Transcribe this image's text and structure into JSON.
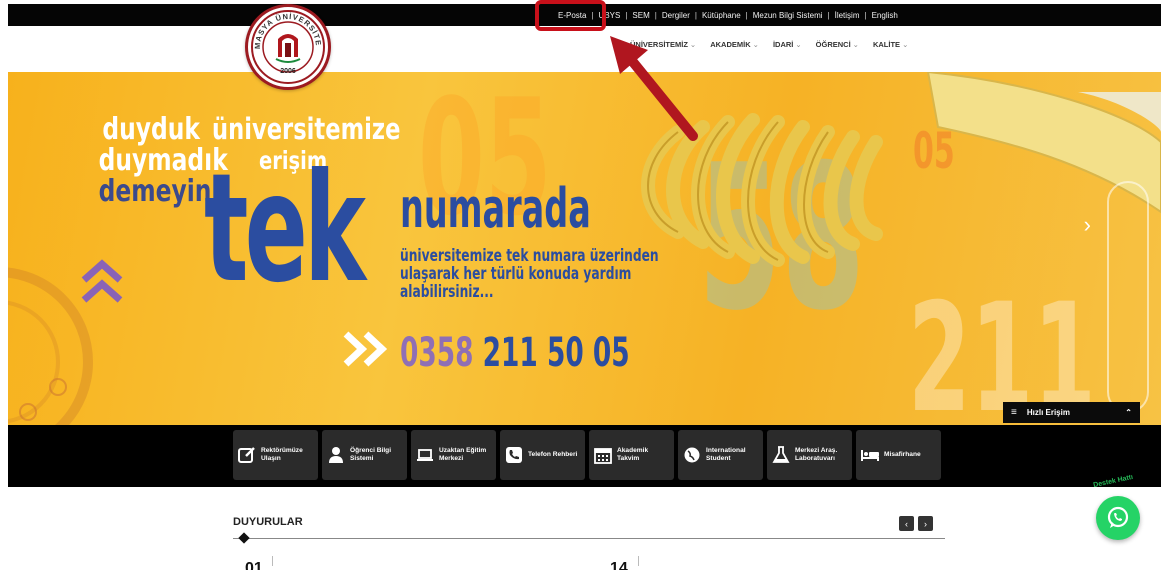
{
  "topbar": {
    "links": [
      "E-Posta",
      "UBYS",
      "SEM",
      "Dergiler",
      "Kütüphane",
      "Mezun Bilgi Sistemi",
      "İletişim",
      "English"
    ]
  },
  "nav": {
    "items": [
      "ÜNİVERSİTEMİZ",
      "AKADEMİK",
      "İDARİ",
      "ÖĞRENCİ",
      "KALİTE"
    ]
  },
  "logo": {
    "text_top": "AMASYA ÜNİVERSİTESİ",
    "year": "2006"
  },
  "hero": {
    "line1": "duyduk",
    "line2": "duymadık",
    "line3": "demeyin",
    "univ": "üniversitemize",
    "erisim": "erişim",
    "tek": "tek",
    "numarada": "numarada",
    "description": "üniversitemize tek numara üzerinden ulaşarak her türlü konuda yardım alabilirsiniz...",
    "phone_prefix": "0358",
    "phone_rest": " 211 50 05",
    "bg_05": "05",
    "bg_58": "58",
    "bg_211": "211",
    "bg_r05": "05"
  },
  "quick_access": {
    "label": "Hızlı Erişim"
  },
  "tiles": [
    {
      "label": "Rektörümüze Ulaşın",
      "icon": "edit-icon"
    },
    {
      "label": "Öğrenci Bilgi Sistemi",
      "icon": "user-icon"
    },
    {
      "label": "Uzaktan Eğitim Merkezi",
      "icon": "laptop-icon"
    },
    {
      "label": "Telefon Rehberi",
      "icon": "phone-icon"
    },
    {
      "label": "Akademik Takvim",
      "icon": "calendar-icon"
    },
    {
      "label": "International Student",
      "icon": "globe-icon"
    },
    {
      "label": "Merkezi Araş. Laboratuvarı",
      "icon": "flask-icon"
    },
    {
      "label": "Misafirhane",
      "icon": "bed-icon"
    }
  ],
  "announcements": {
    "title": "DUYURULAR",
    "date1": "01",
    "date2": "14"
  },
  "whatsapp": {
    "label": "Destek Hattı"
  },
  "colors": {
    "annotation": "#c8101a",
    "brand_red": "#9c1b21",
    "hero_blue": "#2b4da0",
    "whatsapp": "#25d366"
  }
}
